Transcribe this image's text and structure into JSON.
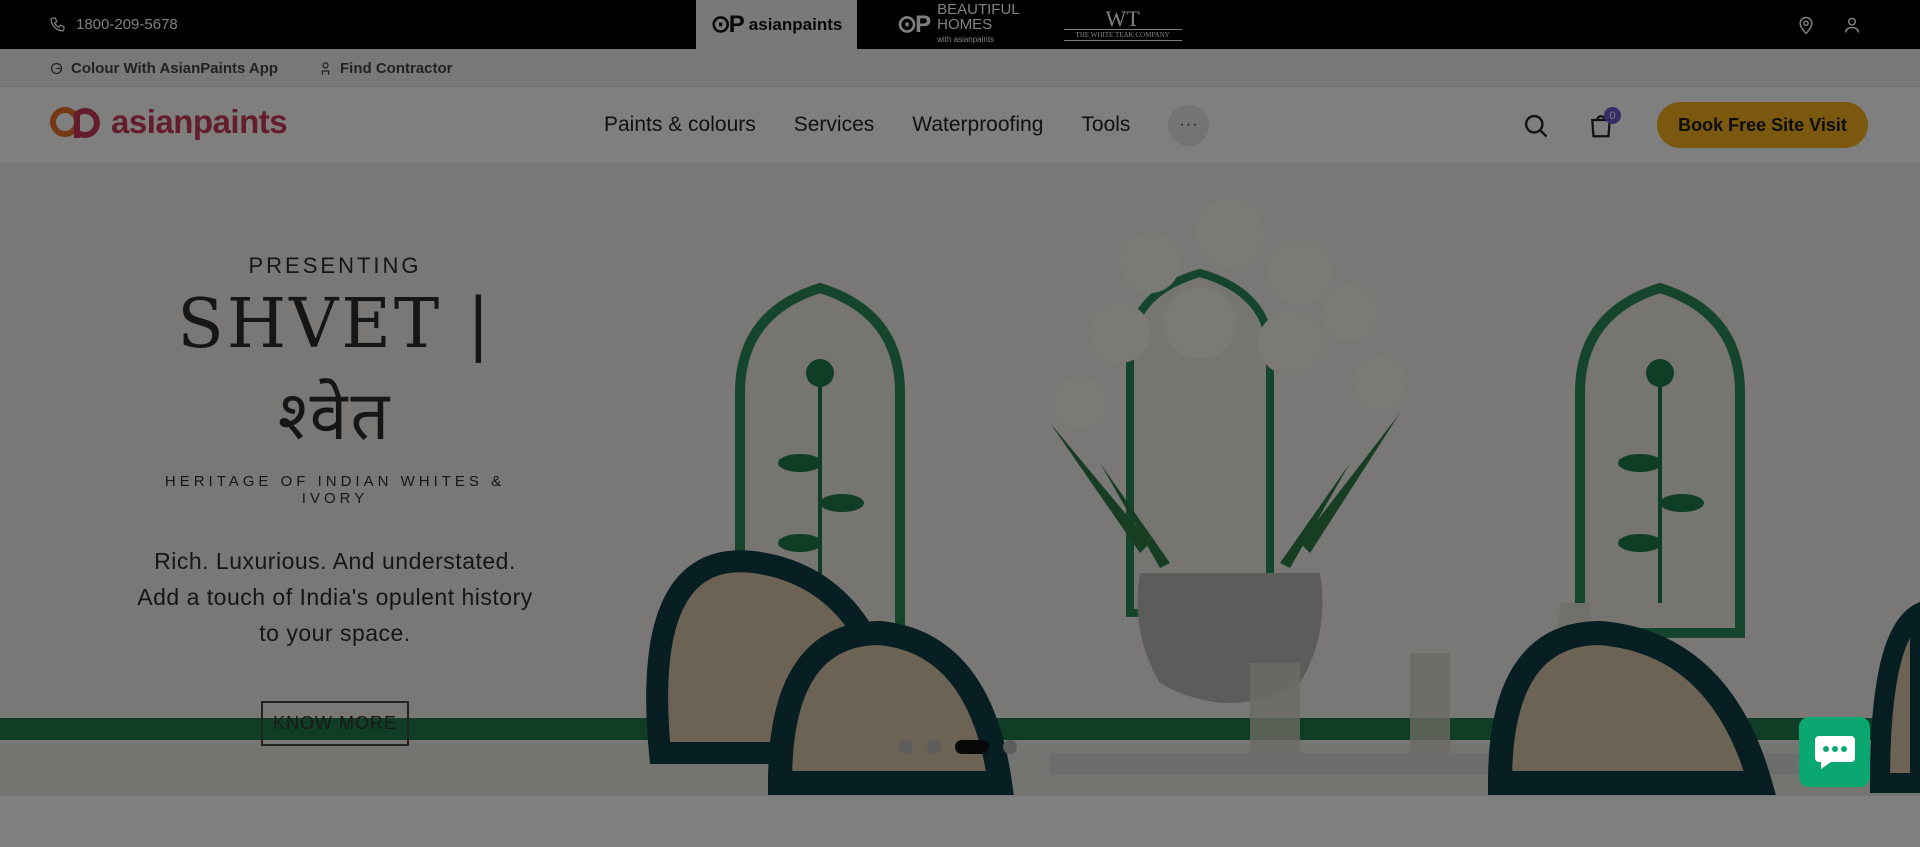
{
  "topbar": {
    "phone": "1800-209-5678",
    "brands": {
      "asianpaints": "asianpaints",
      "beautiful_homes_line1": "BEAUTIFUL",
      "beautiful_homes_line2": "HOMES",
      "beautiful_homes_sub": "with asianpaints",
      "white_teak_mark": "WT",
      "white_teak_name": "THE WHITE TEAK COMPANY"
    }
  },
  "subbar": {
    "app_link": "Colour With AsianPaints App",
    "contractor_link": "Find Contractor"
  },
  "nav": {
    "logo_text": "asianpaints",
    "links": [
      "Paints & colours",
      "Services",
      "Waterproofing",
      "Tools"
    ],
    "more_label": "···",
    "cart_count": "0",
    "book_visit": "Book Free Site Visit"
  },
  "hero": {
    "presenting": "PRESENTING",
    "title": "SHVET | श्वेत",
    "subtitle": "HERITAGE OF INDIAN WHITES & IVORY",
    "description_line1": "Rich. Luxurious. And understated.",
    "description_line2": "Add a touch of India's opulent history",
    "description_line3": "to your space.",
    "cta": "KNOW MORE",
    "carousel": {
      "slide_count": 4,
      "active_index": 2
    }
  },
  "colors": {
    "accent_yellow": "#f5b21d",
    "brand_pink": "#c73a5a",
    "chat_green": "#0aa870",
    "badge_purple": "#6a5acd"
  }
}
